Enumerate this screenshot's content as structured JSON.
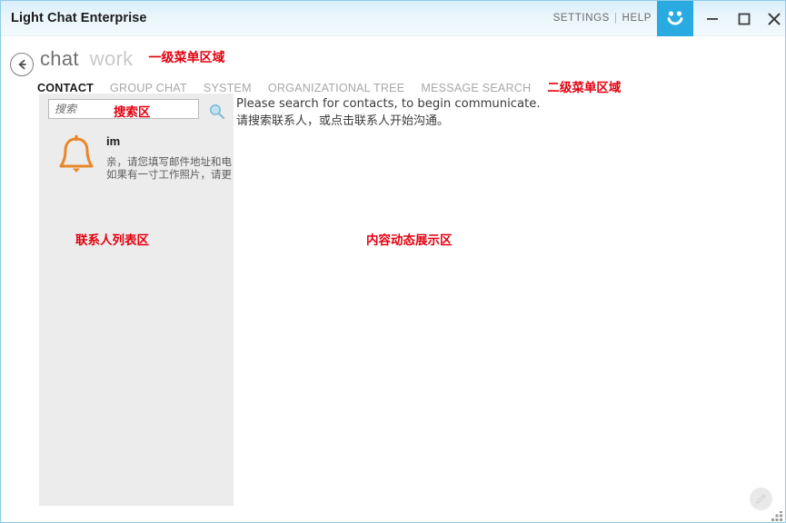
{
  "window": {
    "title": "Light Chat Enterprise",
    "accent_color": "#29abe2",
    "border_color": "#8fcbe8",
    "titlebar_gradient_top": "#d9eefb",
    "annotation_color": "#e3000f",
    "panel_bg": "#ececec"
  },
  "titlebar": {
    "settings_label": "SETTINGS",
    "separator": "|",
    "help_label": "HELP",
    "brand_icon": "smiley-face-icon",
    "minimize_icon": "minimize-icon",
    "maximize_icon": "maximize-icon",
    "close_icon": "close-icon"
  },
  "header": {
    "back_icon": "back-arrow-circle-icon",
    "primary_menu": [
      {
        "label": "chat",
        "state": "active"
      },
      {
        "label": "work",
        "state": "inactive"
      }
    ],
    "primary_annotation": "一级菜单区域",
    "secondary_menu": [
      {
        "label": "CONTACT",
        "state": "active"
      },
      {
        "label": "GROUP CHAT",
        "state": "inactive"
      },
      {
        "label": "SYSTEM",
        "state": "inactive"
      },
      {
        "label": "ORGANIZATIONAL TREE",
        "state": "inactive"
      },
      {
        "label": "MESSAGE SEARCH",
        "state": "inactive"
      }
    ],
    "secondary_annotation": "二级菜单区域"
  },
  "sidebar": {
    "search": {
      "value": "",
      "placeholder": "搜索",
      "annotation": "搜索区",
      "icon": "magnifier-icon"
    },
    "contacts": [
      {
        "name": "im",
        "avatar_icon": "bell-icon",
        "avatar_color": "#e8872a",
        "snippet_line1": "亲，请您填写邮件地址和电",
        "snippet_line2": "如果有一寸工作照片，请更"
      }
    ],
    "annotation": "联系人列表区"
  },
  "content": {
    "hint_en": "Please search for contacts, to begin communicate.",
    "hint_cn": "请搜索联系人，或点击联系人开始沟通。",
    "annotation": "内容动态展示区"
  },
  "footer": {
    "compose_icon": "pencil-compose-icon",
    "resize_icon": "resize-grip-icon"
  }
}
